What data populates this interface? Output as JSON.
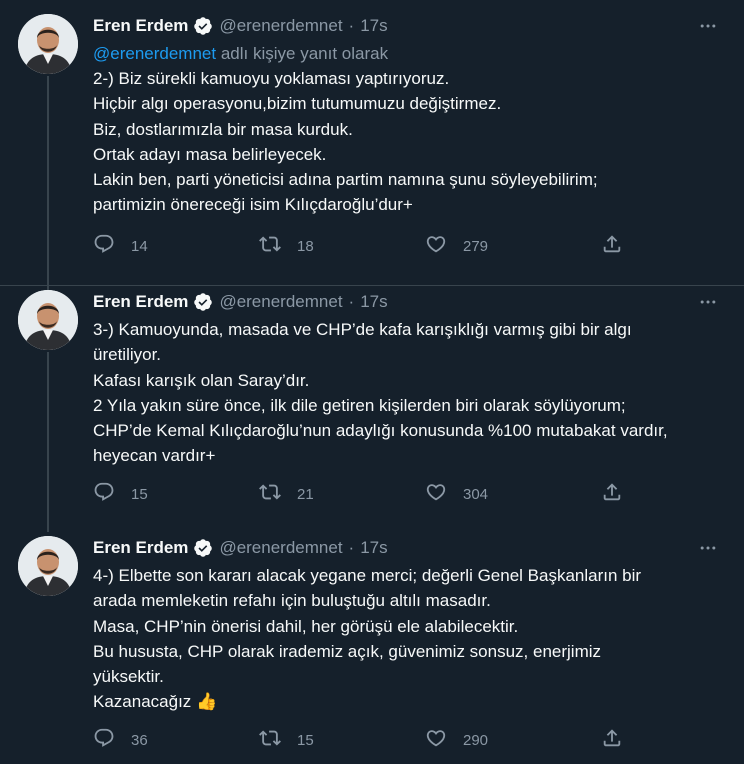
{
  "tweets": [
    {
      "name": "Eren Erdem",
      "handle": "@erenerdemnet",
      "dot": "·",
      "time": "17s",
      "reply_mention": "@erenerdemnet",
      "reply_suffix": " adlı kişiye yanıt olarak",
      "lines": [
        "2-) Biz sürekli kamuoyu yoklaması yaptırıyoruz.",
        "Hiçbir algı operasyonu,bizim tutumumuzu değiştirmez.",
        "Biz, dostlarımızla bir masa kurduk.",
        "Ortak adayı masa belirleyecek.",
        "Lakin ben, parti yöneticisi adına partim namına şunu söyleyebilirim;",
        "partimizin önereceği isim Kılıçdaroğlu’dur+"
      ],
      "replies": "14",
      "retweets": "18",
      "likes": "279"
    },
    {
      "name": "Eren Erdem",
      "handle": "@erenerdemnet",
      "dot": "·",
      "time": "17s",
      "lines": [
        "3-) Kamuoyunda, masada ve CHP’de kafa karışıklığı varmış gibi bir algı",
        "üretiliyor.",
        "Kafası karışık olan Saray’dır.",
        "2 Yıla yakın süre önce, ilk dile getiren kişilerden biri olarak söylüyorum;",
        "CHP’de Kemal Kılıçdaroğlu’nun adaylığı konusunda %100 mutabakat vardır,",
        "heyecan vardır+"
      ],
      "replies": "15",
      "retweets": "21",
      "likes": "304"
    },
    {
      "name": "Eren Erdem",
      "handle": "@erenerdemnet",
      "dot": "·",
      "time": "17s",
      "lines": [
        "4-) Elbette son kararı alacak yegane merci; değerli Genel Başkanların bir",
        "arada memleketin refahı için buluştuğu altılı masadır.",
        "Masa, CHP’nin önerisi dahil, her görüşü ele alabilecektir.",
        "Bu hususta, CHP olarak irademiz açık, güvenimiz sonsuz, enerjimiz",
        "yüksektir.",
        "Kazanacağız 👍"
      ],
      "replies": "36",
      "retweets": "15",
      "likes": "290"
    }
  ],
  "icons": {
    "reply": "reply-icon",
    "retweet": "retweet-icon",
    "like": "heart-icon",
    "share": "share-icon",
    "more": "more-icon",
    "verified": "verified-badge-icon"
  },
  "colors": {
    "background": "#15202b",
    "text": "#f7f9f9",
    "secondary": "#8b98a5",
    "accent": "#1d9bf0",
    "line": "#38444d",
    "thumb": "#f5b934"
  }
}
